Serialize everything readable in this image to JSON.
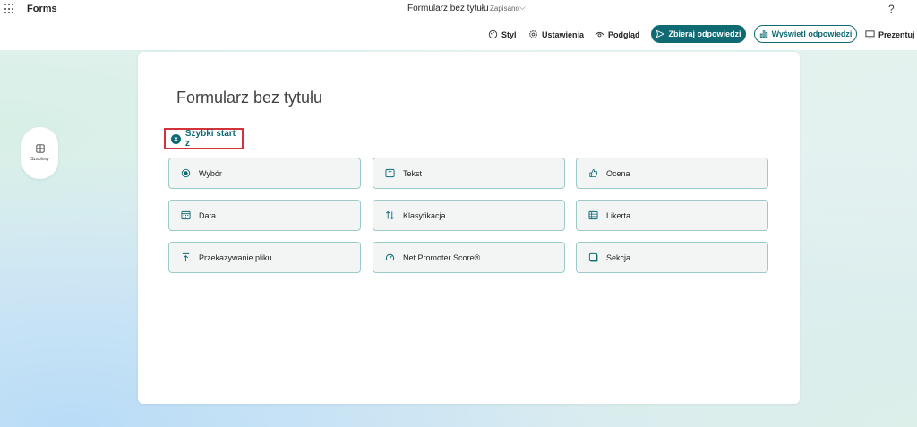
{
  "app": {
    "name": "Forms"
  },
  "document": {
    "title": "Formularz bez tytułu",
    "separator": "-",
    "status": "Zapisano"
  },
  "help": {
    "label": "?"
  },
  "toolbar": {
    "style": "Styl",
    "settings": "Ustawienia",
    "preview": "Podgląd",
    "collect": "Zbieraj odpowiedzi",
    "view_responses": "Wyświetl odpowiedzi",
    "present": "Prezentuj"
  },
  "sidebar": {
    "templates_label": "Szablony"
  },
  "form": {
    "title": "Formularz bez tytułu",
    "quick_start": "Szybki start z",
    "options": [
      {
        "label": "Wybór",
        "icon": "radio-icon"
      },
      {
        "label": "Tekst",
        "icon": "text-icon"
      },
      {
        "label": "Ocena",
        "icon": "thumb-icon"
      },
      {
        "label": "Data",
        "icon": "calendar-icon"
      },
      {
        "label": "Klasyfikacja",
        "icon": "ranking-icon"
      },
      {
        "label": "Likerta",
        "icon": "likert-icon"
      },
      {
        "label": "Przekazywanie pliku",
        "icon": "upload-icon"
      },
      {
        "label": "Net Promoter Score®",
        "icon": "gauge-icon"
      },
      {
        "label": "Sekcja",
        "icon": "section-icon"
      }
    ]
  },
  "colors": {
    "accent": "#0f6a73",
    "highlight": "#d13438",
    "option_border": "#9ccbc7"
  }
}
